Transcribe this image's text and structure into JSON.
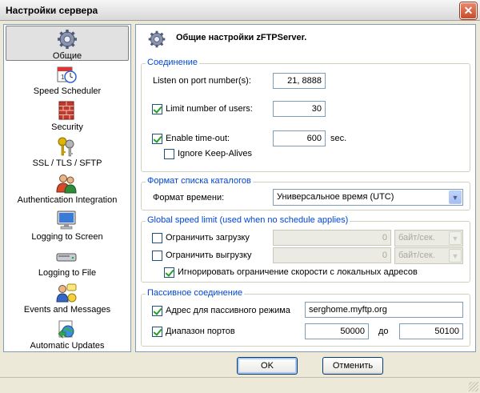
{
  "window": {
    "title": "Настройки сервера",
    "close_glyph": "✕"
  },
  "sidebar": {
    "items": [
      {
        "label": "Общие",
        "icon": "gear-icon",
        "selected": true
      },
      {
        "label": "Speed Scheduler",
        "icon": "calendar-clock-icon"
      },
      {
        "label": "Security",
        "icon": "firewall-icon"
      },
      {
        "label": "SSL / TLS / SFTP",
        "icon": "keys-icon"
      },
      {
        "label": "Authentication Integration",
        "icon": "users-icon"
      },
      {
        "label": "Logging to Screen",
        "icon": "monitor-icon"
      },
      {
        "label": "Logging to File",
        "icon": "disk-icon"
      },
      {
        "label": "Events and Messages",
        "icon": "messages-icon"
      },
      {
        "label": "Automatic Updates",
        "icon": "globe-update-icon"
      }
    ]
  },
  "main": {
    "title": "Общие настройки zFTPServer.",
    "connection": {
      "legend": "Соединение",
      "port_label": "Listen on port number(s):",
      "port_value": "21, 8888",
      "limit_users_label": "Limit number of users:",
      "limit_users_checked": true,
      "limit_users_value": "30",
      "timeout_label": "Enable time-out:",
      "timeout_checked": true,
      "timeout_value": "600",
      "timeout_unit": "sec.",
      "keepalive_label": "Ignore Keep-Alives",
      "keepalive_checked": false
    },
    "listing": {
      "legend": "Формат списка каталогов",
      "time_format_label": "Формат времени:",
      "time_format_value": "Универсальное время (UTC)"
    },
    "speed": {
      "legend": "Global speed limit (used when no schedule applies)",
      "download_label": "Ограничить загрузку",
      "download_checked": false,
      "download_value": "0",
      "download_unit": "байт/сек.",
      "upload_label": "Ограничить выгрузку",
      "upload_checked": false,
      "upload_value": "0",
      "upload_unit": "байт/сек.",
      "ignore_local_label": "Игнорировать ограничение скорости с локальных адресов",
      "ignore_local_checked": true
    },
    "passive": {
      "legend": "Пассивное соединение",
      "address_label": "Адрес для пассивного режима",
      "address_checked": true,
      "address_value": "serghome.myftp.org",
      "range_label": "Диапазон портов",
      "range_checked": true,
      "range_from": "50000",
      "range_to_label": "до",
      "range_to": "50100"
    }
  },
  "buttons": {
    "ok": "OK",
    "cancel": "Отменить"
  },
  "colors": {
    "accent": "#0046d5",
    "border": "#7f9db9",
    "background": "#ece9d8"
  }
}
